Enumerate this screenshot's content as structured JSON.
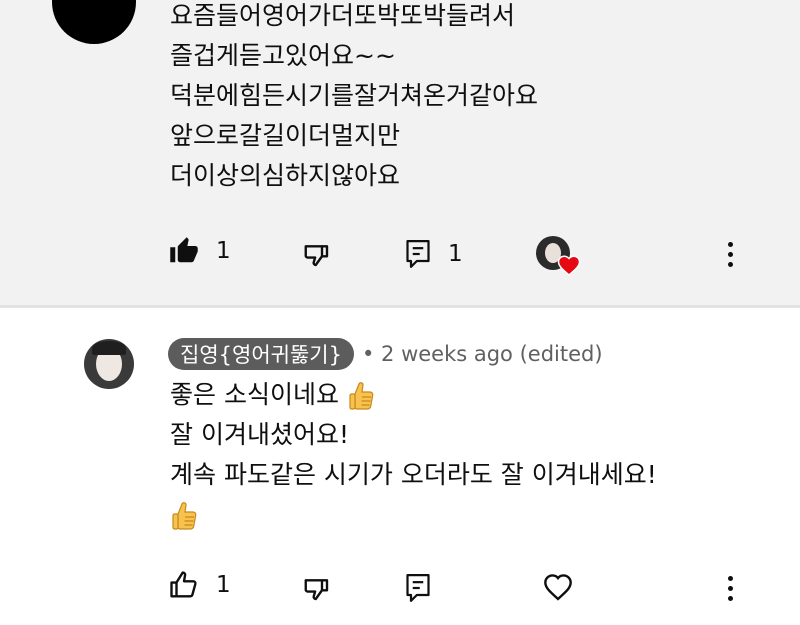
{
  "top_comment": {
    "lines": [
      "요즘들어영어가더또박또박들려서",
      "즐겁게듣고있어요~~",
      "덕분에힘든시기를잘거쳐온거같아요",
      "앞으로갈길이더멀지만",
      "더이상의심하지않아요"
    ],
    "like_count": "1",
    "reply_count": "1",
    "like_icon": "thumb-up-filled-icon",
    "dislike_icon": "thumb-down-icon",
    "reply_icon": "comment-reply-icon",
    "creator_heart": "creator-heart-icon",
    "more_icon": "more-vert-icon"
  },
  "reply_comment": {
    "author": "집영{영어귀뚫기}",
    "meta": "• 2 weeks ago (edited)",
    "lines": [
      "좋은 소식이네요 ",
      "잘 이겨내셨어요!",
      "계속 파도같은 시기가 오더라도 잘 이겨내세요!"
    ],
    "emoji_icon": "thumbs-up-emoji",
    "like_count": "1",
    "like_icon": "thumb-up-outline-icon",
    "dislike_icon": "thumb-down-icon",
    "reply_icon": "comment-reply-icon",
    "heart_icon": "heart-outline-icon",
    "more_icon": "more-vert-icon"
  },
  "colors": {
    "top_background": "#f2f2f2",
    "chip_background": "#5c5c5c",
    "meta_text": "#606060",
    "heart_red": "#e50914"
  }
}
